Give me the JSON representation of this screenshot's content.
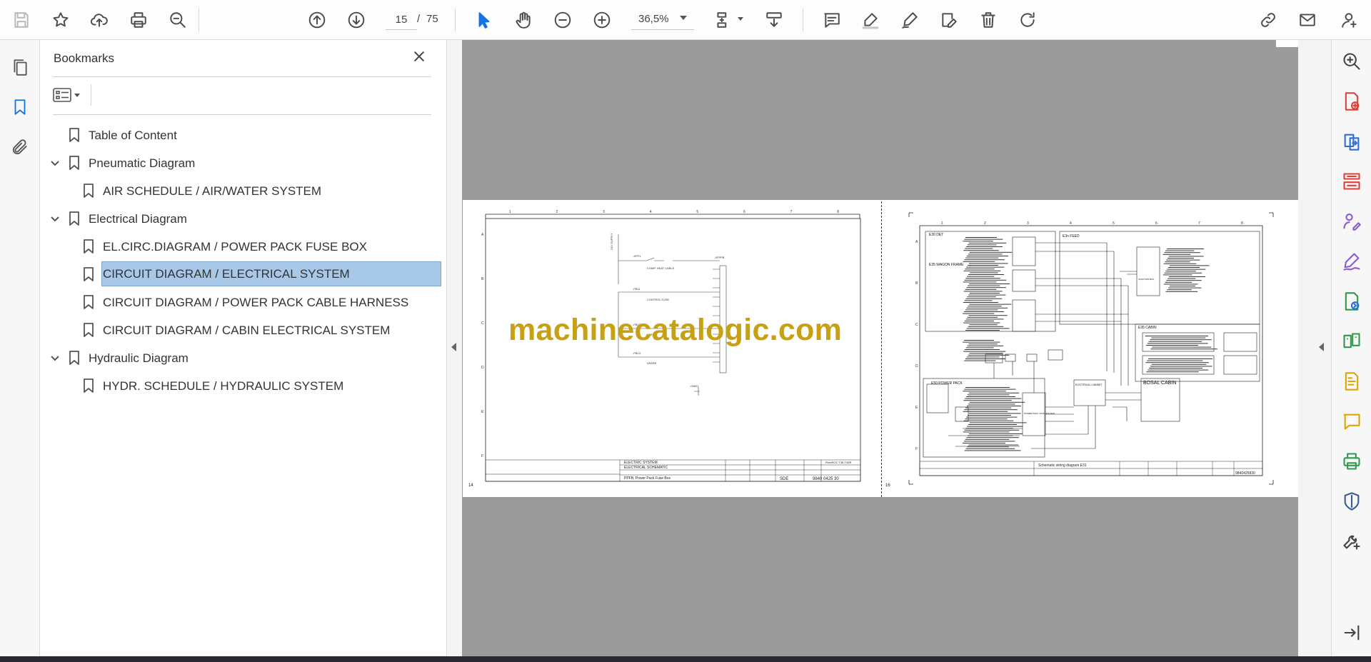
{
  "toolbar": {
    "page_current": "15",
    "page_separator": "/",
    "page_total": "75",
    "zoom": "36,5%",
    "icons": [
      "save-icon",
      "bookmark-star-icon",
      "upload-cloud-icon",
      "print-icon",
      "zoom-search-icon",
      "page-up-icon",
      "page-down-icon",
      "select-cursor-icon",
      "hand-icon",
      "zoom-out-icon",
      "zoom-in-icon",
      "page-fit-icon",
      "scroll-mode-icon",
      "comment-icon",
      "highlight-icon",
      "sign-icon",
      "edit-text-icon",
      "delete-icon",
      "rotate-icon",
      "share-link-icon",
      "email-icon",
      "account-icon"
    ]
  },
  "left_rail": {
    "icons": [
      "page-thumbnails-icon",
      "bookmarks-icon",
      "attachments-icon"
    ]
  },
  "bookmarks": {
    "title": "Bookmarks",
    "items": [
      {
        "label": "Table of Content",
        "level": 0,
        "expandable": false,
        "selected": false
      },
      {
        "label": "Pneumatic Diagram",
        "level": 0,
        "expandable": true,
        "selected": false
      },
      {
        "label": "AIR SCHEDULE / AIR/WATER SYSTEM",
        "level": 1,
        "expandable": false,
        "selected": false
      },
      {
        "label": "Electrical Diagram",
        "level": 0,
        "expandable": true,
        "selected": false
      },
      {
        "label": "EL.CIRC.DIAGRAM / POWER PACK FUSE BOX",
        "level": 1,
        "expandable": false,
        "selected": false
      },
      {
        "label": "CIRCUIT DIAGRAM / ELECTRICAL SYSTEM",
        "level": 1,
        "expandable": false,
        "selected": true
      },
      {
        "label": "CIRCUIT DIAGRAM / POWER PACK CABLE HARNESS",
        "level": 1,
        "expandable": false,
        "selected": false
      },
      {
        "label": "CIRCUIT DIAGRAM / CABIN ELECTRICAL SYSTEM",
        "level": 1,
        "expandable": false,
        "selected": false
      },
      {
        "label": "Hydraulic Diagram",
        "level": 0,
        "expandable": true,
        "selected": false
      },
      {
        "label": "HYDR. SCHEDULE / HYDRAULIC SYSTEM",
        "level": 1,
        "expandable": false,
        "selected": false
      }
    ]
  },
  "document": {
    "watermark": "machinecatalogic.com",
    "left_page": {
      "page_no": "14",
      "col_labels": [
        "1",
        "2",
        "3",
        "4",
        "5",
        "6",
        "7",
        "8"
      ],
      "row_labels": [
        "A",
        "B",
        "C",
        "D",
        "E",
        "F"
      ],
      "title_block": [
        "ELECTRIC SYSTEM",
        "ELECTRICAL SCHEMATIC",
        "PPFB, Power Pack Fuse Box",
        "9840 0425 30",
        "SDE",
        "FlexiROC T35-T45R"
      ]
    },
    "right_page": {
      "page_no": "16",
      "col_labels": [
        "1",
        "2",
        "3",
        "4",
        "5",
        "6",
        "7",
        "8"
      ],
      "row_labels": [
        "A",
        "B",
        "C",
        "D",
        "E",
        "F"
      ],
      "blocks": [
        "E30 DET",
        "E3n FEED",
        "E35 WAGON FRAME",
        "E35 CABIN",
        "E50 POWER PACK",
        "BOSAL CABIN",
        "ELECTRICAL CABINET",
        "POWER PACK JUNCTION BOX",
        "JUNCTION BOX"
      ],
      "title_block": [
        "Schematic wiring diagram E31",
        "9840425830"
      ]
    }
  },
  "right_rail": {
    "icons": [
      "zoom-icon",
      "create-pdf-icon",
      "export-pdf-icon",
      "organize-pages-icon",
      "request-signature-icon",
      "fill-sign-icon",
      "convert-icon",
      "compare-icon",
      "edit-pdf-icon",
      "comment-tool-icon",
      "print-production-icon",
      "protect-icon",
      "more-tools-icon",
      "collapse-panel-icon"
    ],
    "colors": {
      "red": "#e0403a",
      "blue": "#2d6fd8",
      "purple": "#8a5bd1",
      "green": "#2e9a4a",
      "yellow": "#e0a500",
      "darkblue": "#3a5a9a"
    }
  }
}
